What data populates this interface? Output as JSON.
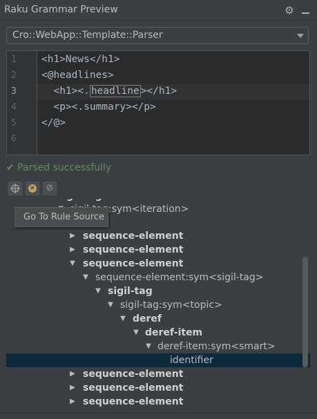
{
  "window": {
    "title": "Raku Grammar Preview"
  },
  "grammar_selector": {
    "value": "Cro::WebApp::Template::Parser"
  },
  "editor": {
    "line_numbers": [
      "1",
      "2",
      "3",
      "4",
      "5",
      "6"
    ],
    "active_line": "3",
    "lines": {
      "l1": "<h1>News</h1>",
      "l2": "<@headlines>",
      "l3_pre": "  <h1><.",
      "l3_hl": "headline",
      "l3_post": "></h1>",
      "l4": "  <p><.summary></p>",
      "l5": "</@>",
      "l6": ""
    }
  },
  "status": {
    "check": "✔",
    "text": "Parsed successfully",
    "color": "#6a8759"
  },
  "tree_toolbar": {
    "buttons": [
      "go-to-source-icon",
      "clear-icon",
      "disable-icon"
    ]
  },
  "tooltip": {
    "text": "Go To Rule Source"
  },
  "tree": {
    "rows": [
      {
        "label": "sigil-tag",
        "bold": true,
        "arrow": ""
      },
      {
        "label": "sigil-tag:sym<iteration>",
        "bold": false,
        "arrow": "▼"
      },
      {
        "label": "sequence-element",
        "bold": true,
        "arrow": "▶"
      },
      {
        "label": "sequence-element",
        "bold": true,
        "arrow": "▶"
      },
      {
        "label": "sequence-element",
        "bold": true,
        "arrow": "▼"
      },
      {
        "label": "sequence-element:sym<sigil-tag>",
        "bold": false,
        "arrow": "▼"
      },
      {
        "label": "sigil-tag",
        "bold": true,
        "arrow": "▼"
      },
      {
        "label": "sigil-tag:sym<topic>",
        "bold": false,
        "arrow": "▼"
      },
      {
        "label": "deref",
        "bold": true,
        "arrow": "▼"
      },
      {
        "label": "deref-item",
        "bold": true,
        "arrow": "▼"
      },
      {
        "label": "deref-item:sym<smart>",
        "bold": false,
        "arrow": "▼"
      },
      {
        "label": "identifier",
        "bold": false,
        "arrow": ""
      },
      {
        "label": "sequence-element",
        "bold": true,
        "arrow": "▶"
      },
      {
        "label": "sequence-element",
        "bold": true,
        "arrow": "▶"
      },
      {
        "label": "sequence-element",
        "bold": true,
        "arrow": "▶"
      }
    ],
    "selected_label": "identifier"
  }
}
